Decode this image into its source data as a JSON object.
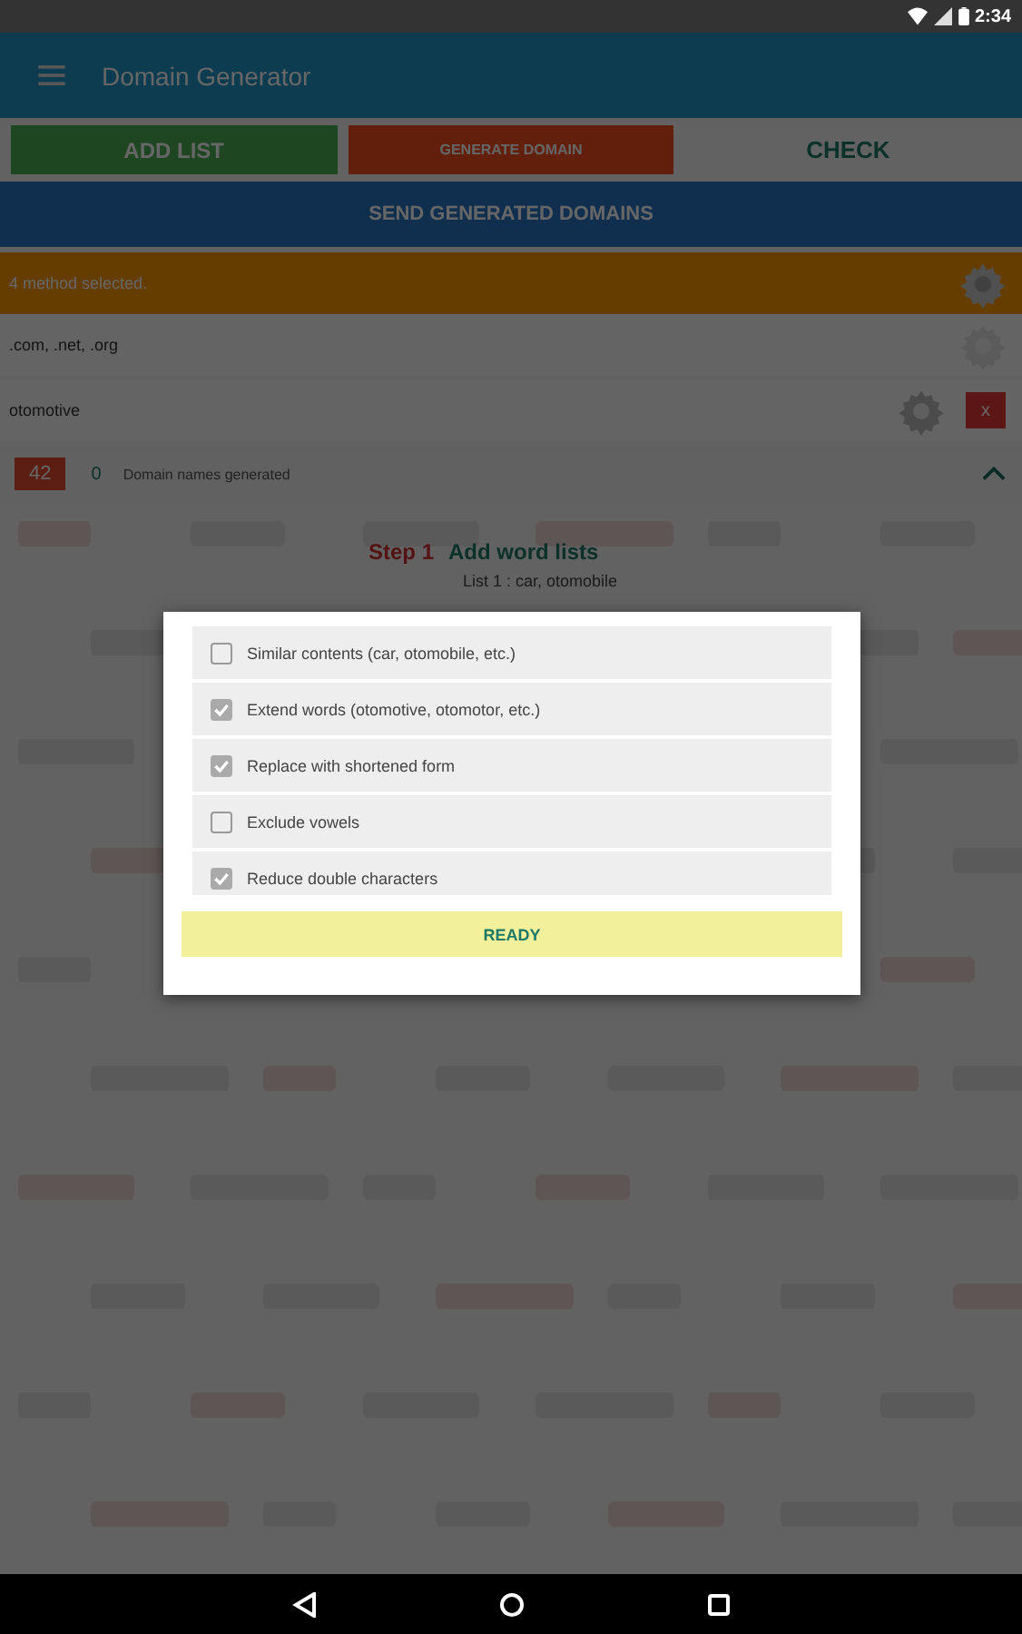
{
  "status_bar": {
    "time": "2:34"
  },
  "app_bar": {
    "title": "Domain Generator"
  },
  "actions": [
    {
      "label": "ADD LIST",
      "kind": "green"
    },
    {
      "label": "GENERATE DOMAIN",
      "kind": "red"
    },
    {
      "label": "CHECK",
      "kind": "grey"
    }
  ],
  "send_button": "SEND GENERATED DOMAINS",
  "methods_bar": {
    "text": "4 method selected."
  },
  "extensions_row": {
    "text": ".com, .net, .org"
  },
  "word_row": {
    "text": "otomotive",
    "remove": "x"
  },
  "summary": {
    "count": "42",
    "checked": "0",
    "label": "Domain names generated"
  },
  "steps": {
    "step": "Step 1",
    "title": "Add word lists",
    "lines": [
      "List 1 : car, otomobile"
    ]
  },
  "dialog": {
    "options": [
      {
        "label": "Similar contents (car, otomobile, etc.)",
        "checked": false
      },
      {
        "label": "Extend words (otomotive, otomotor, etc.)",
        "checked": true
      },
      {
        "label": "Replace with shortened form",
        "checked": true
      },
      {
        "label": "Exclude vowels",
        "checked": false
      },
      {
        "label": "Reduce double characters",
        "checked": true
      }
    ],
    "button": "READY"
  }
}
